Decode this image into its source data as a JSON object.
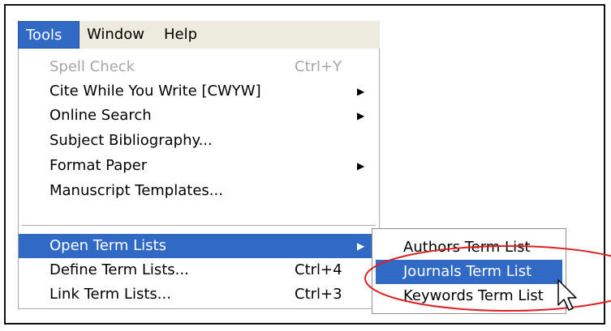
{
  "menubar": {
    "items": [
      {
        "label": "Tools"
      },
      {
        "label": "Window"
      },
      {
        "label": "Help"
      }
    ]
  },
  "tools_menu": {
    "items": [
      {
        "label": "Spell Check",
        "shortcut": "Ctrl+Y",
        "state": "disabled"
      },
      {
        "label": "Cite While You Write [CWYW]",
        "submenu": true
      },
      {
        "label": "Online Search",
        "submenu": true
      },
      {
        "label": "Subject Bibliography..."
      },
      {
        "label": "Format Paper",
        "submenu": true
      },
      {
        "label": "Manuscript Templates..."
      },
      {
        "label": "Open Term Lists",
        "submenu": true,
        "state": "highlighted"
      },
      {
        "label": "Define Term Lists...",
        "shortcut": "Ctrl+4"
      },
      {
        "label": "Link Term Lists...",
        "shortcut": "Ctrl+3"
      }
    ]
  },
  "term_lists_submenu": {
    "items": [
      {
        "label": "Authors Term List"
      },
      {
        "label": "Journals Term List",
        "state": "highlighted"
      },
      {
        "label": "Keywords Term List"
      }
    ]
  },
  "icons": {
    "submenu_arrow": "submenu-arrow-icon",
    "cursor": "mouse-pointer-icon"
  },
  "colors": {
    "highlight": "#316ac5",
    "menubar_bg": "#ecebdd",
    "disabled_text": "#a6a6a6",
    "annotation_ellipse": "#e02020"
  }
}
